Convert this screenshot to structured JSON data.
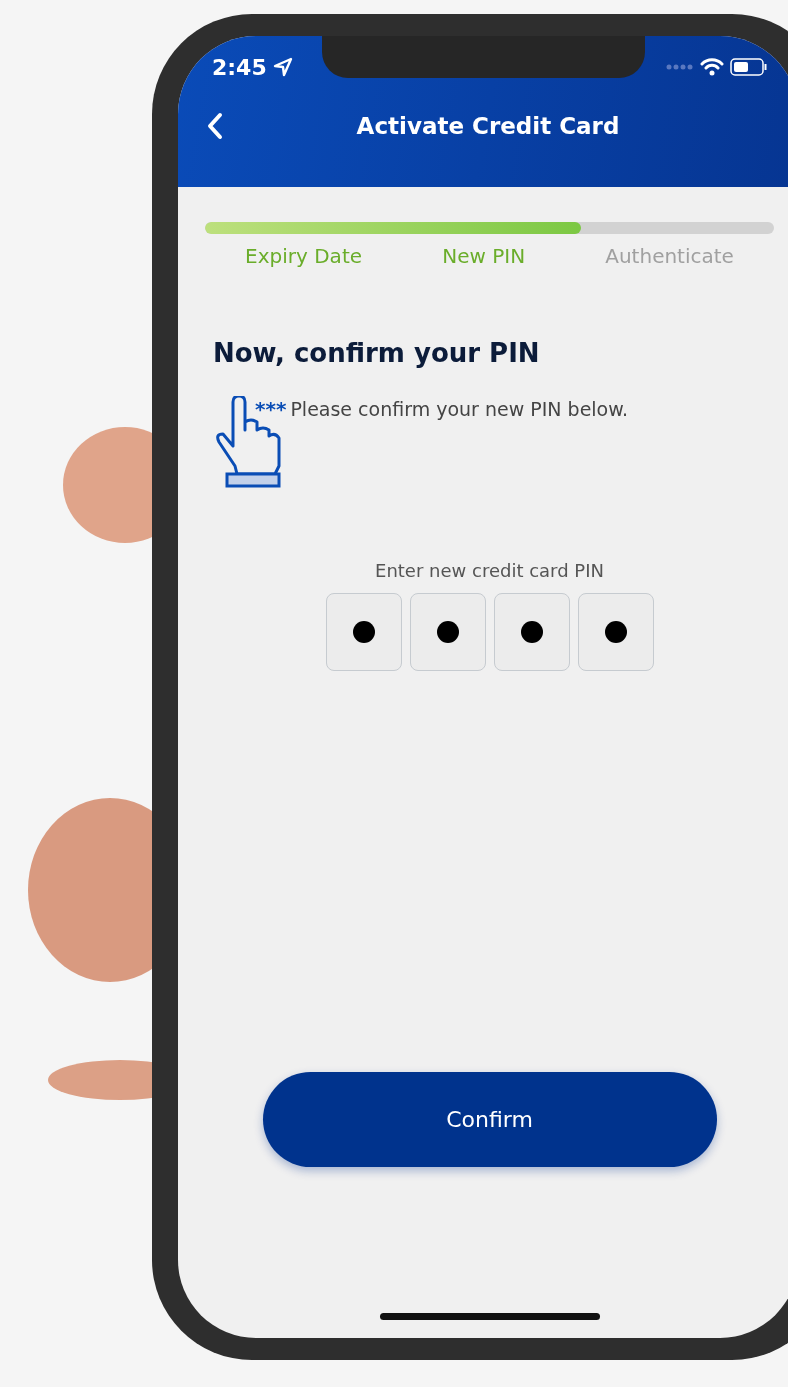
{
  "status_bar": {
    "time": "2:45"
  },
  "header": {
    "title": "Activate Credit Card"
  },
  "progress": {
    "level": 0.66,
    "steps": [
      {
        "label": "Expiry Date",
        "completed": true
      },
      {
        "label": "New PIN",
        "completed": true
      },
      {
        "label": "Authenticate",
        "completed": false
      }
    ]
  },
  "heading": "Now, confirm your PIN",
  "instruction": {
    "asterisks": "***",
    "text": "Please confirm your new PIN below."
  },
  "pin": {
    "label": "Enter new credit card PIN",
    "digits": [
      {
        "filled": true
      },
      {
        "filled": true
      },
      {
        "filled": true
      },
      {
        "filled": true
      }
    ]
  },
  "button": {
    "label": "Confirm"
  }
}
